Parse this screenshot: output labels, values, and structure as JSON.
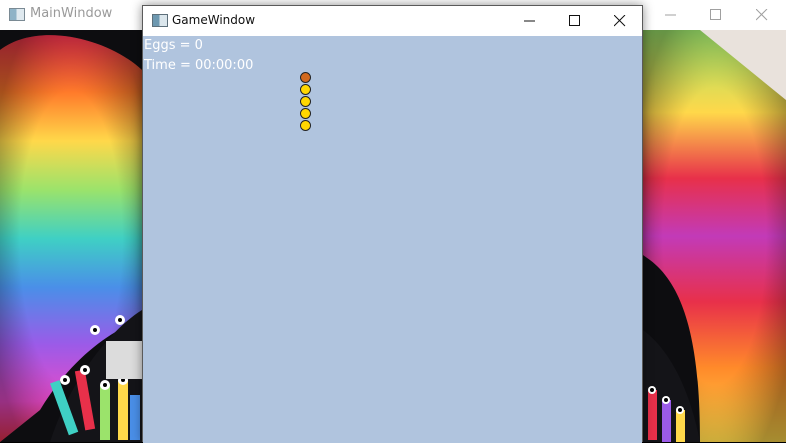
{
  "main_window": {
    "title": "MainWindow",
    "icon": "app-window-icon",
    "controls": [
      "minimize-icon",
      "maximize-icon",
      "close-icon"
    ]
  },
  "game_window": {
    "title": "GameWindow",
    "icon": "app-window-icon",
    "controls": [
      "minimize-icon",
      "maximize-icon",
      "close-icon"
    ],
    "canvas_color": "#b0c4de",
    "hud": {
      "eggs_text": "Eggs = 0",
      "time_text": "Time = 00:00:00"
    },
    "snake": {
      "head_color": "#d2691e",
      "body_color": "#ffd700",
      "segments": 5
    }
  }
}
